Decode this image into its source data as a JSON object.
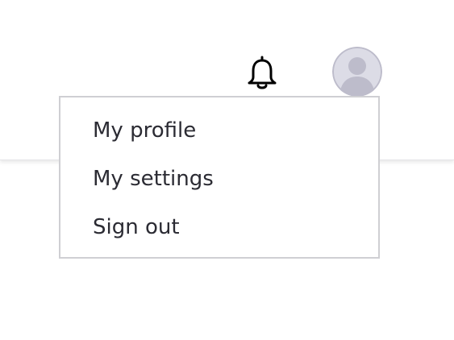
{
  "header": {
    "notifications_icon": "bell-icon",
    "avatar_icon": "user-avatar-icon",
    "colors": {
      "avatar_background": "#dcdce6",
      "avatar_figure": "#bdbccb",
      "menu_text": "#2b2b33",
      "menu_border": "#cfcfd3"
    }
  },
  "user_menu": {
    "items": [
      {
        "label": "My profile"
      },
      {
        "label": "My settings"
      },
      {
        "label": "Sign out"
      }
    ]
  }
}
